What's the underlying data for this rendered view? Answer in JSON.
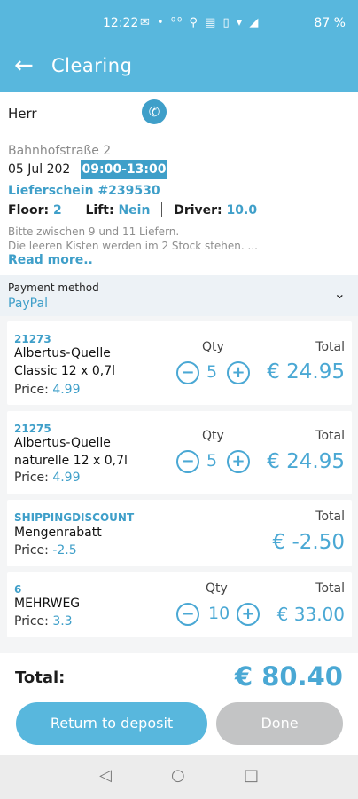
{
  "status_bar": {
    "time": "12:22",
    "icons_text": "✉ • ⁰⁰ ⚲ ▤ ▯ ▾ ◢",
    "battery": "87 %"
  },
  "app_bar": {
    "back_icon": "←",
    "title": "Clearing"
  },
  "order": {
    "salutation": "Herr",
    "phone_icon": "✆",
    "street": "Bahnhofstraße 2",
    "date": "05 Jul 202",
    "time_slot": "09:00-13:00",
    "delivery_note_label": "Lieferschein #239530",
    "floor_label": "Floor:",
    "floor_value": "2",
    "lift_label": "Lift:",
    "lift_value": "Nein",
    "driver_label": "Driver:",
    "driver_value": "10.0",
    "note_line1": "Bitte zwischen 9 und 11 Liefern.",
    "note_line2": "Die leeren Kisten werden im 2 Stock stehen. ...",
    "read_more": "Read more.."
  },
  "payment": {
    "label": "Payment method",
    "value": "PayPal",
    "chevron_icon": "⌄"
  },
  "items": [
    {
      "code": "21273",
      "name_line1": "Albertus-Quelle",
      "name_line2": "Classic 12 x 0,7l",
      "price_label": "Price:",
      "price": "4.99",
      "qty_label": "Qty",
      "qty": "5",
      "total_label": "Total",
      "total": "€ 24.95"
    },
    {
      "code": "21275",
      "name_line1": "Albertus-Quelle",
      "name_line2": "naturelle 12 x 0,7l",
      "price_label": "Price:",
      "price": "4.99",
      "qty_label": "Qty",
      "qty": "5",
      "total_label": "Total",
      "total": "€ 24.95"
    },
    {
      "code": "SHIPPINGDISCOUNT",
      "name_line1": "Mengenrabatt",
      "price_label": "Price:",
      "price": "-2.5",
      "total_label": "Total",
      "total": "€ -2.50"
    },
    {
      "code": "6",
      "name_line1": "MEHRWEG",
      "price_label": "Price:",
      "price": "3.3",
      "qty_label": "Qty",
      "qty": "10",
      "total_label": "Total",
      "total": "€ 33.00"
    }
  ],
  "icons": {
    "minus": "−",
    "plus": "+"
  },
  "footer": {
    "total_label": "Total:",
    "total_value": "€ 80.40",
    "return_button": "Return to deposit",
    "done_button": "Done"
  },
  "nav": {
    "back": "◁",
    "home": "○",
    "recents": "□"
  },
  "colors": {
    "primary": "#58b7dd",
    "accent": "#3f9fc9",
    "done_disabled": "#c3c4c5"
  }
}
